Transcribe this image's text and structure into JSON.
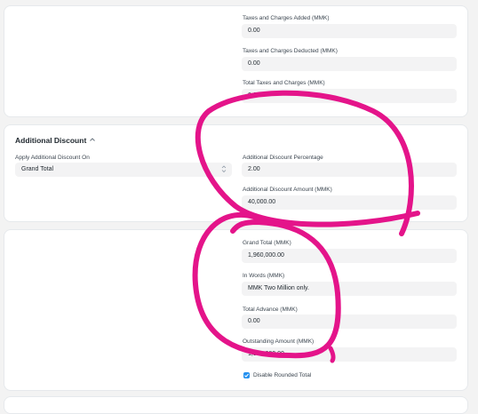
{
  "taxes": {
    "added_label": "Taxes and Charges Added (MMK)",
    "added_value": "0.00",
    "deducted_label": "Taxes and Charges Deducted (MMK)",
    "deducted_value": "0.00",
    "total_label": "Total Taxes and Charges (MMK)",
    "total_value": "0.00"
  },
  "discount": {
    "section_title": "Additional Discount",
    "apply_on_label": "Apply Additional Discount On",
    "apply_on_value": "Grand Total",
    "percentage_label": "Additional Discount Percentage",
    "percentage_value": "2.00",
    "amount_label": "Additional Discount Amount (MMK)",
    "amount_value": "40,000.00"
  },
  "totals": {
    "grand_total_label": "Grand Total (MMK)",
    "grand_total_value": "1,960,000.00",
    "in_words_label": "In Words (MMK)",
    "in_words_value": "MMK Two Million only.",
    "total_advance_label": "Total Advance (MMK)",
    "total_advance_value": "0.00",
    "outstanding_label": "Outstanding Amount (MMK)",
    "outstanding_value": "1,960,000.00",
    "disable_rounded_label": "Disable Rounded Total"
  },
  "colors": {
    "annotation": "#e4148a",
    "checkbox": "#2490ef"
  },
  "icons": {
    "collapse": "chevron-up-icon",
    "select": "select-arrows-icon",
    "check": "checkmark-icon"
  }
}
